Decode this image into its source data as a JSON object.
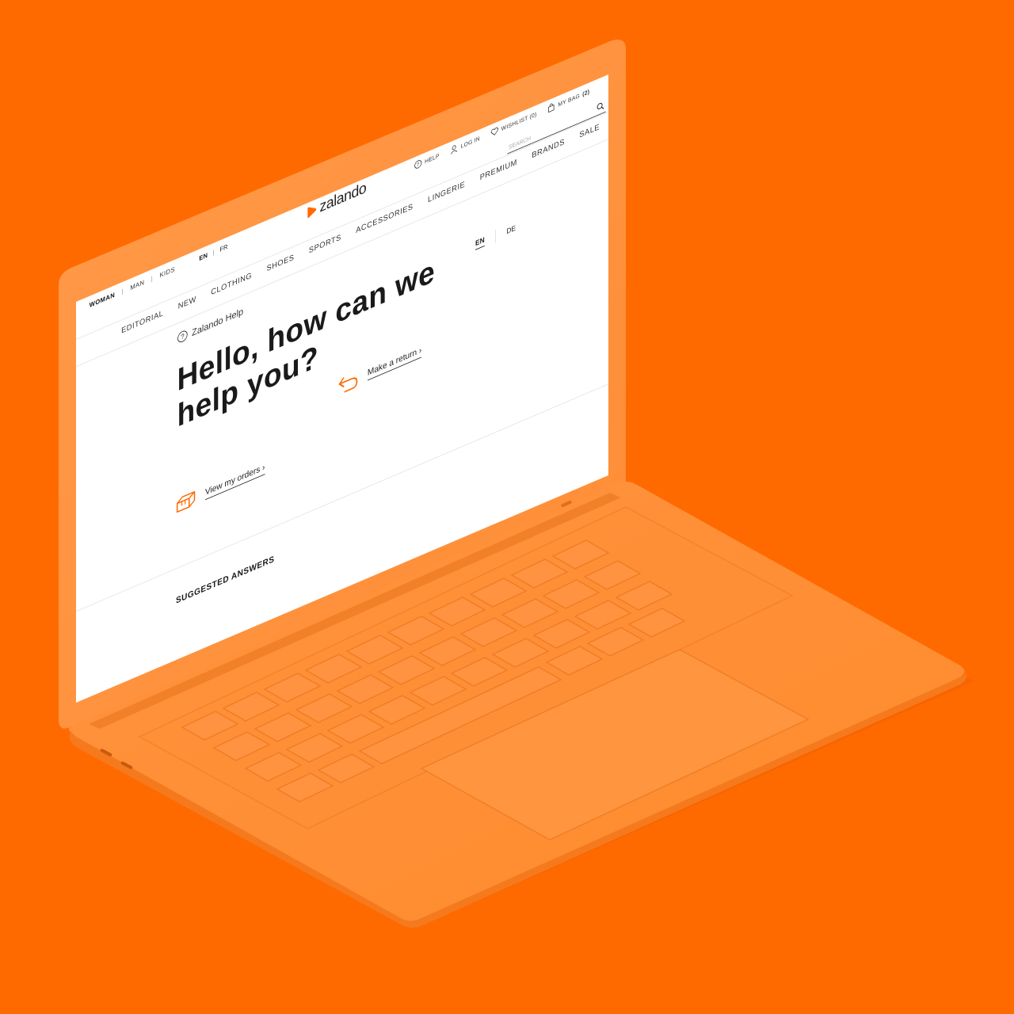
{
  "colors": {
    "background": "#ff6a00",
    "laptop_body": "#ff8a2e",
    "accent": "#ff6900",
    "text": "#1a1a1a"
  },
  "top": {
    "gender": [
      "WOMAN",
      "MAN",
      "KIDS"
    ],
    "gender_active": "WOMAN",
    "languages": [
      "EN",
      "FR"
    ],
    "language_active": "EN"
  },
  "logo": {
    "text": "zalando",
    "icon": "zalando-play-mark"
  },
  "utility": {
    "help": "HELP",
    "login": "LOG IN",
    "wishlist": "WISHLIST (0)",
    "bag_label": "MY BAG",
    "bag_count": "(2)"
  },
  "search": {
    "placeholder": "SEARCH",
    "icon": "search-icon"
  },
  "nav": [
    "EDITORIAL",
    "NEW",
    "CLOTHING",
    "SHOES",
    "SPORTS",
    "ACCESSORIES",
    "LINGERIE",
    "PREMIUM",
    "BRANDS",
    "SALE"
  ],
  "lang_switch": {
    "active": "EN",
    "other": "DE"
  },
  "help": {
    "breadcrumb": "Zalando Help",
    "hero_line1": "Hello, how can we",
    "hero_line2": "help you?",
    "return_label": "Make a return ›",
    "orders_label": "View my orders ›",
    "suggested": "SUGGESTED ANSWERS"
  }
}
